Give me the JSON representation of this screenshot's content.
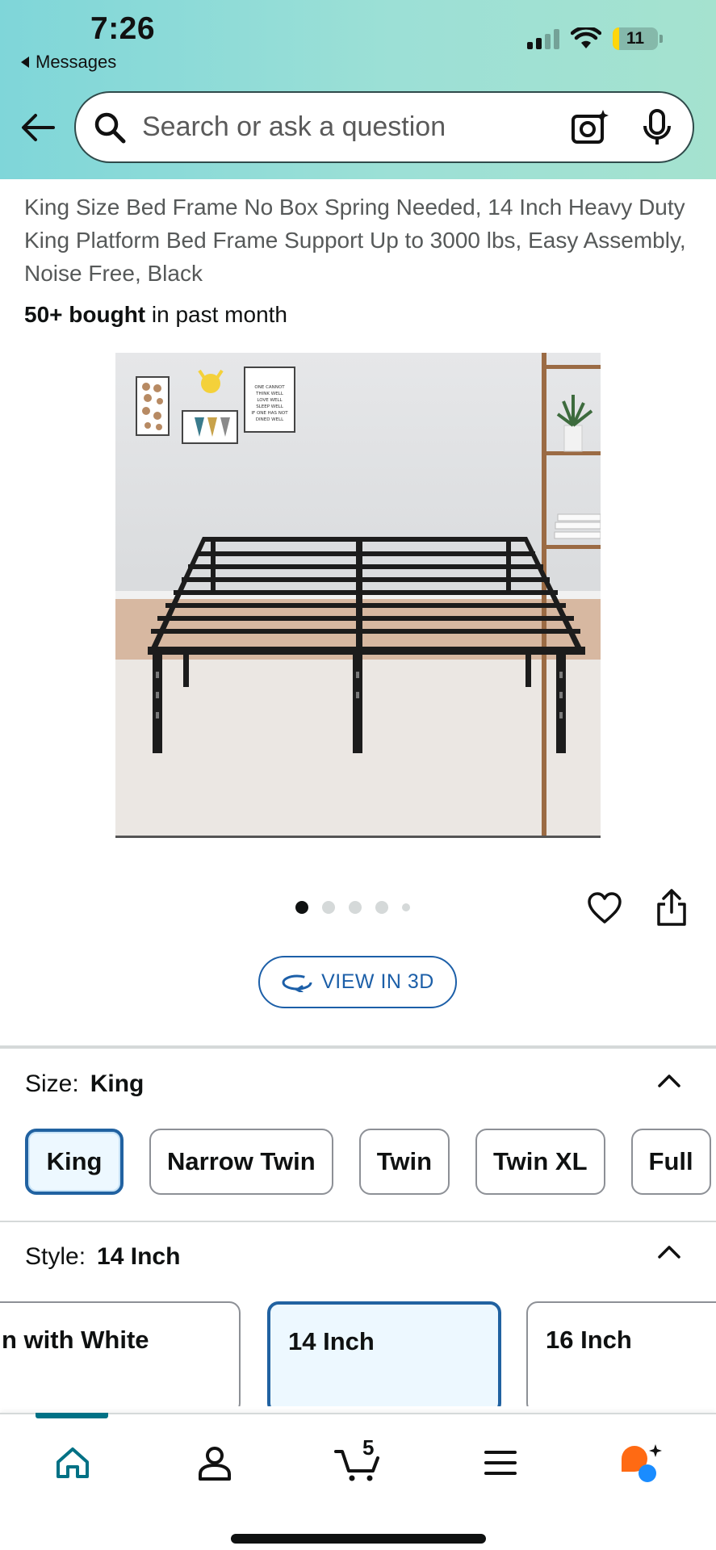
{
  "status_bar": {
    "time": "7:26",
    "back_app": "Messages",
    "battery": "11"
  },
  "search": {
    "placeholder": "Search or ask a question"
  },
  "product": {
    "title": "King Size Bed Frame No Box Spring Needed, 14 Inch Heavy Duty King Platform Bed Frame Support Up to 3000 lbs, Easy Assembly, Noise Free, Black",
    "bought_bold": "50+ bought",
    "bought_rest": " in past month",
    "image_current": 1,
    "image_count": 5,
    "poster_lines": [
      "ONE CANNOT",
      "THINK WELL",
      "LOVE WELL",
      "SLEEP WELL",
      "IF ONE HAS NOT",
      "DINED WELL"
    ]
  },
  "view3d": {
    "label": "VIEW IN 3D"
  },
  "size": {
    "label": "Size:",
    "value": "King",
    "options": [
      "King",
      "Narrow Twin",
      "Twin",
      "Twin XL",
      "Full"
    ],
    "selected_index": 0
  },
  "style": {
    "label": "Style:",
    "value": "14 Inch",
    "options": [
      "n with White",
      "14 Inch",
      "16 Inch"
    ],
    "selected_index": 1
  },
  "tabbar": {
    "cart_count": "5",
    "icons": [
      "home-icon",
      "account-icon",
      "cart-icon",
      "menu-icon",
      "rufus-assistant-icon"
    ]
  },
  "colors": {
    "accent_teal": "#007185",
    "selected_blue": "#2162a1",
    "selected_bg": "#edf8ff",
    "link_blue": "#1c5fa8"
  }
}
